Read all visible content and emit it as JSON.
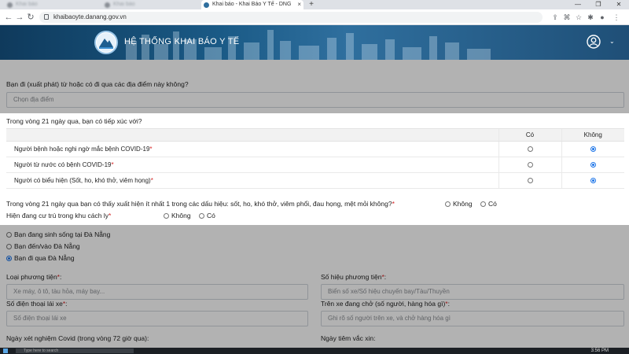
{
  "browser": {
    "tabs": [
      {
        "title": "Khai báo",
        "state": "blurred"
      },
      {
        "title": "Khai báo - Khai Báo Y Tế - DNG",
        "state": "active"
      }
    ],
    "new_tab": "+",
    "url": "khaibaoyte.danang.gov.vn",
    "window_controls": [
      "—",
      "❐",
      "✕"
    ]
  },
  "header": {
    "title": "HỆ THỐNG KHAI BÁO Y TẾ",
    "user_menu_caret": "⌄"
  },
  "form": {
    "places_question": "Bạn đi (xuất phát) từ hoặc có đi qua các địa điểm này không?",
    "places_placeholder": "Chọn địa điểm",
    "contact_title": "Trong vòng 21 ngày qua, bạn có tiếp xúc với?",
    "contact_columns": [
      "Có",
      "Không"
    ],
    "contact_rows": [
      {
        "label": "Người bệnh hoặc nghi ngờ mắc bệnh COVID-19",
        "required": "*",
        "answer": "Không"
      },
      {
        "label": "Người từ nước có bệnh COVID-19",
        "required": "*",
        "answer": "Không"
      },
      {
        "label": "Người có biểu hiện (Sốt, ho, khó thở, viêm họng)",
        "required": "*",
        "answer": "Không"
      }
    ],
    "symptoms_question": "Trong vòng 21 ngày qua bạn có thấy xuất hiện ít nhất 1 trong các dấu hiệu: sốt, ho, khó thở, viêm phổi, đau họng, mệt mỏi không?",
    "symptoms_options": [
      "Không",
      "Có"
    ],
    "quarantine_question": "Hiện đang cư trú trong khu cách ly",
    "quarantine_options": [
      "Không",
      "Có"
    ],
    "required_mark": "*",
    "residence_options": [
      {
        "label": "Bạn đang sinh sống tại Đà Nẵng",
        "checked": false
      },
      {
        "label": "Bạn đến/vào Đà Nẵng",
        "checked": false
      },
      {
        "label": "Bạn đi qua Đà Nẵng",
        "checked": true
      }
    ],
    "vehicle_type_label": "Loại phương tiện",
    "vehicle_type_placeholder": "Xe máy, ô tô, tàu hỏa, máy bay...",
    "vehicle_number_label": "Số hiệu phương tiện",
    "vehicle_number_placeholder": "Biển số xe/Số hiệu chuyến bay/Tàu/Thuyền",
    "driver_phone_label": "Số điện thoại lái xe",
    "driver_phone_placeholder": "Số điện thoại lái xe",
    "cargo_label": "Trên xe đang chở (số người, hàng hóa gì)",
    "cargo_placeholder": "Ghi rõ số người trên xe, và chở hàng hóa gì",
    "covid_test_label": "Ngày xét nghiệm Covid (trong vòng 72 giờ qua):",
    "vaccine_label": "Ngày tiêm vắc xin:"
  },
  "taskbar": {
    "search": "Type here to search",
    "clock": "3:56 PM"
  }
}
